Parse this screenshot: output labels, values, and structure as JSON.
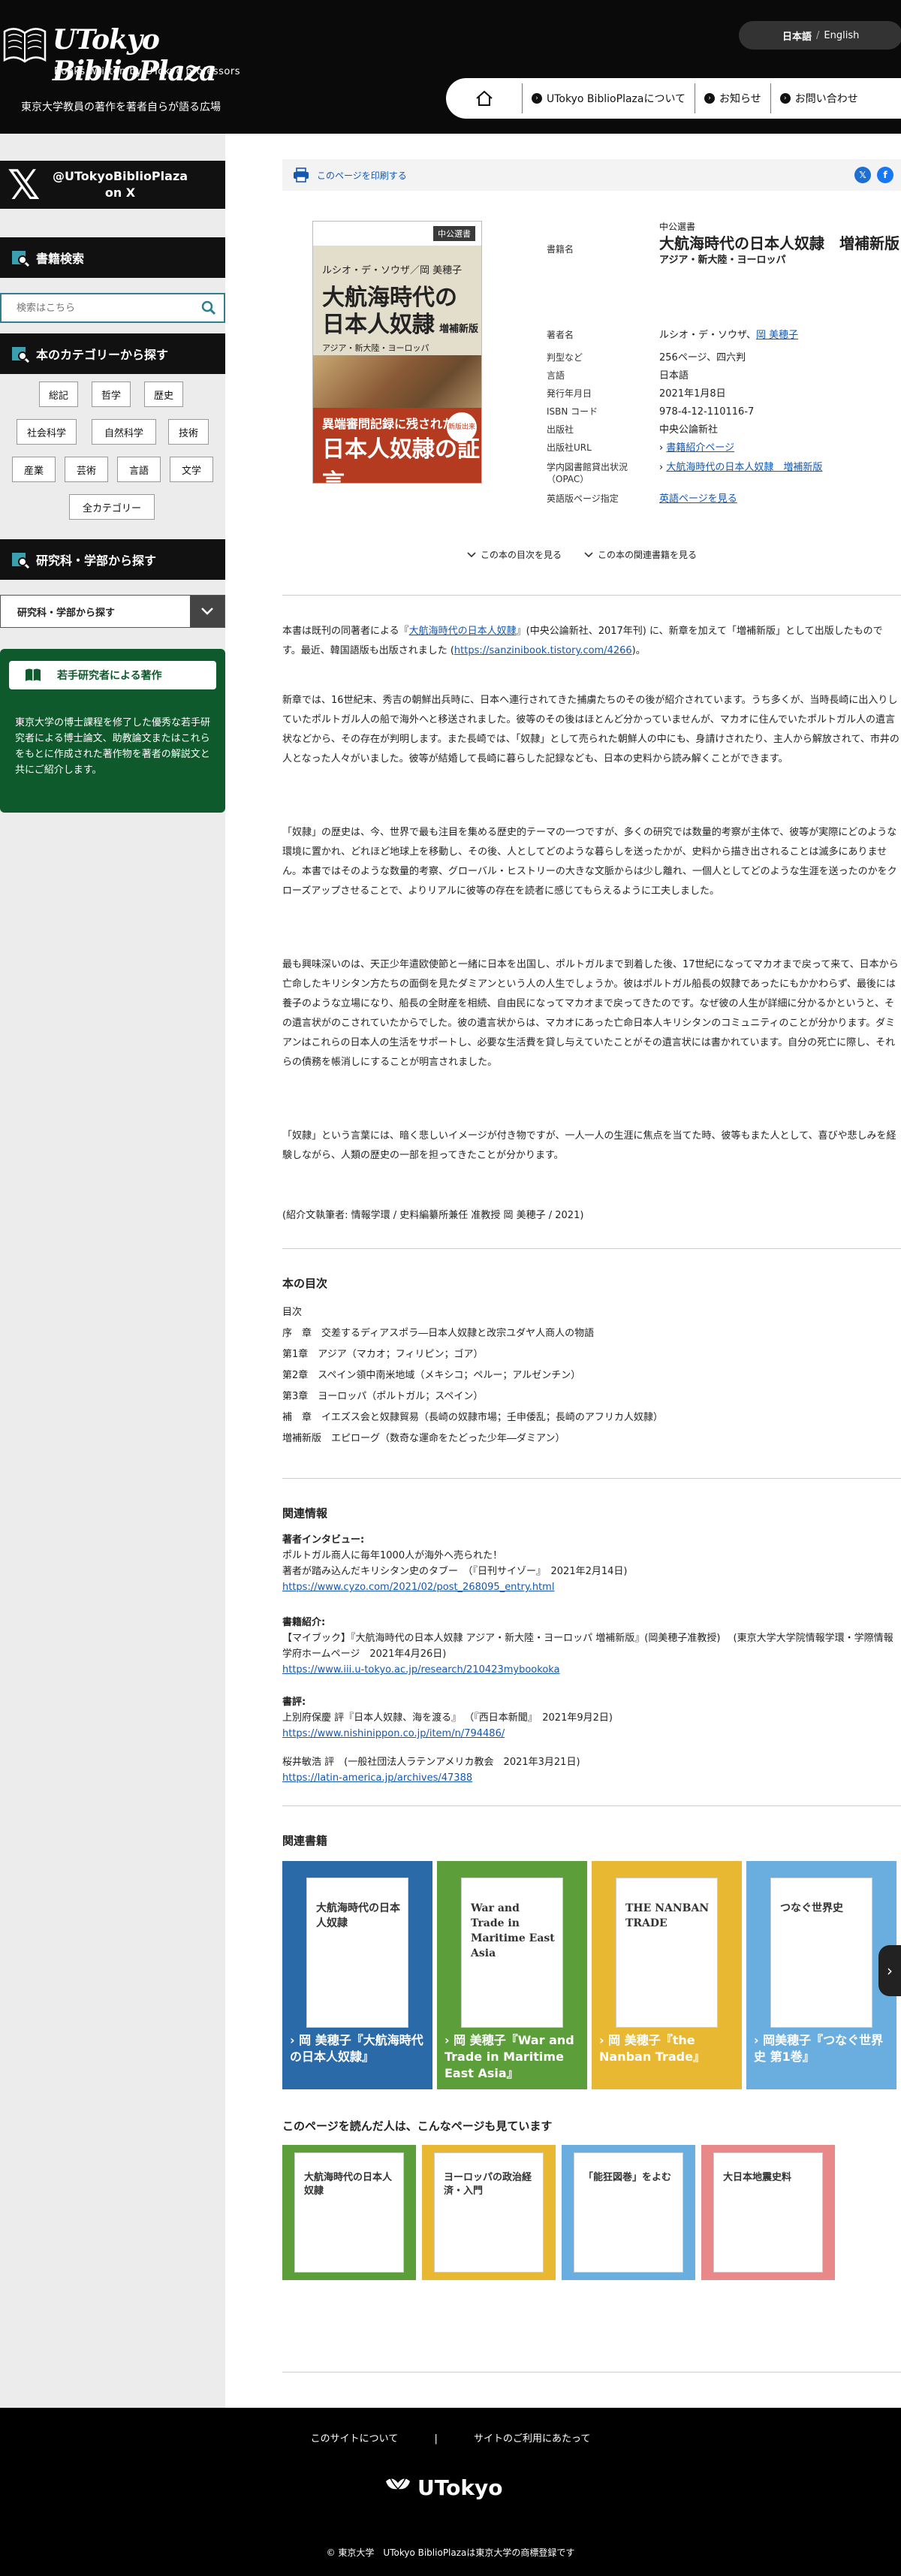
{
  "header": {
    "logo_title": "UTokyo BiblioPlaza",
    "logo_sub": "Books written by UTokyo professors",
    "tagline": "東京大学教員の著作を著者自らが語る広場",
    "lang_current": "日本語",
    "lang_other": "English",
    "nav": [
      "UTokyo BiblioPlazaについて",
      "お知らせ",
      "お問い合わせ"
    ]
  },
  "sidebar": {
    "x_label_1": "@UTokyoBiblioPlaza",
    "x_label_2": "on X",
    "search_title": "書籍検索",
    "search_placeholder": "検索はこちら",
    "category_title": "本のカテゴリーから探す",
    "categories": [
      "総記",
      "哲学",
      "歴史",
      "社会科学",
      "自然科学",
      "技術",
      "産業",
      "芸術",
      "言語",
      "文学",
      "全カテゴリー"
    ],
    "dept_title": "研究科・学部から探す",
    "dept_select": "研究科・学部から探す",
    "young_title": "若手研究者による著作",
    "young_text": "東京大学の博士課程を修了した優秀な若手研究者による博士論文、助教論文またはこれらをもとに作成された著作物を著者の解説文と共にご紹介します。"
  },
  "printbar": {
    "label": "このページを印刷する"
  },
  "cover": {
    "series": "中公選書",
    "author": "ルシオ・デ・ソウザ／岡 美穂子",
    "title_l1": "大航海時代の",
    "title_l2": "日本人奴隷",
    "edition": "増補新版",
    "subtitle": "アジア・新大陸・ヨーロッパ",
    "band1": "異端審問記録に残された",
    "band2": "日本人奴隷の証言",
    "badge": "新版出来"
  },
  "meta": {
    "label_title": "書籍名",
    "publisher_series": "中公選書",
    "title": "大航海時代の日本人奴隷　増補新版",
    "subtitle": "アジア・新大陸・ヨーロッパ",
    "rows": [
      {
        "label": "著者名",
        "value": "ルシオ・デ・ソウザ、"
      },
      {
        "label": "判型など",
        "value": "256ページ、四六判"
      },
      {
        "label": "言語",
        "value": "日本語"
      },
      {
        "label": "発行年月日",
        "value": "2021年1月8日"
      },
      {
        "label": "ISBN コード",
        "value": "978-4-12-110116-7"
      },
      {
        "label": "出版社",
        "value": "中央公論新社"
      },
      {
        "label": "出版社URL",
        "value": "書籍紹介ページ"
      },
      {
        "label": "学内図書館貸出状況（OPAC）",
        "value": "大航海時代の日本人奴隷　増補新版"
      },
      {
        "label": "英語版ページ指定",
        "value": "英語ページを見る"
      }
    ],
    "author_link": "岡 美穂子"
  },
  "toggles": [
    "この本の目次を見る",
    "この本の関連書籍を見る"
  ],
  "article": {
    "p1_a": "本書は既刊の同著者による『",
    "p1_link": "大航海時代の日本人奴隷",
    "p1_b": "』(中央公論新社、2017年刊) に、新章を加えて「増補新版」として出版したものです。最近、韓国語版も出版されました (",
    "p1_url": "https://sanzinibook.tistory.com/4266",
    "p1_c": ")。",
    "p2": "新章では、16世紀末、秀吉の朝鮮出兵時に、日本へ連行されてきた捕虜たちのその後が紹介されています。うち多くが、当時長崎に出入りしていたポルトガル人の船で海外へと移送されました。彼等のその後はほとんど分かっていませんが、マカオに住んでいたポルトガル人の遺言状などから、その存在が判明します。また長崎では、「奴隷」として売られた朝鮮人の中にも、身請けされたり、主人から解放されて、市井の人となった人々がいました。彼等が結婚して長崎に暮らした記録なども、日本の史料から読み解くことができます。",
    "p3": "「奴隷」の歴史は、今、世界で最も注目を集める歴史的テーマの一つですが、多くの研究では数量的考察が主体で、彼等が実際にどのような環境に置かれ、どれほど地球上を移動し、その後、人としてどのような暮らしを送ったかが、史料から描き出されることは滅多にありません。本書ではそのような数量的考察、グローバル・ヒストリーの大きな文脈からは少し離れ、一個人としてどのような生涯を送ったのかをクローズアップさせることで、よりリアルに彼等の存在を読者に感じてもらえるように工夫しました。",
    "p4": "最も興味深いのは、天正少年遣欧使節と一緒に日本を出国し、ポルトガルまで到着した後、17世紀になってマカオまで戻って来て、日本から亡命したキリシタン方たちの面倒を見たダミアンという人の人生でしょうか。彼はポルトガル船長の奴隷であったにもかかわらず、最後には養子のような立場になり、船長の全財産を相続、自由民になってマカオまで戻ってきたのです。なぜ彼の人生が詳細に分かるかというと、その遺言状がのこされていたからでした。彼の遺言状からは、マカオにあった亡命日本人キリシタンのコミュニティのことが分かります。ダミアンはこれらの日本人の生活をサポートし、必要な生活費を貸し与えていたことがその遺言状には書かれています。自分の死亡に際し、それらの債務を帳消しにすることが明言されました。",
    "p5": "「奴隷」という言葉には、暗く悲しいイメージが付き物ですが、一人一人の生涯に焦点を当てた時、彼等もまた人として、喜びや悲しみを経験しながら、人類の歴史の一部を担ってきたことが分かります。",
    "p6": "(紹介文執筆者: 情報学環 / 史料編纂所兼任 准教授 岡 美穂子 / 2021)"
  },
  "toc": {
    "title": "本の目次",
    "items": [
      "目次",
      "序　章　交差するディアスポラ―日本人奴隷と改宗ユダヤ人商人の物語",
      "第1章　アジア（マカオ；フィリピン；ゴア）",
      "第2章　スペイン領中南米地域（メキシコ；ペルー；アルゼンチン）",
      "第3章　ヨーロッパ（ポルトガル；スペイン）",
      "補　章　イエズス会と奴隷貿易（長崎の奴隷市場；壬申倭乱；長崎のアフリカ人奴隷）",
      "増補新版　エピローグ（数奇な運命をたどった少年―ダミアン）"
    ]
  },
  "related": {
    "title": "関連情報",
    "i1_head": "著者インタビュー:",
    "i1_l1": "ポルトガル商人に毎年1000人が海外へ売られた！",
    "i1_l2": "著者が踏み込んだキリシタン史のタブー　（『日刊サイゾー』　2021年2月14日)",
    "i1_url": "https://www.cyzo.com/2021/02/post_268095_entry.html",
    "i2_head": "書籍紹介:",
    "i2_l1": "【マイブック】『大航海時代の日本人奴隷 アジア・新大陸・ヨーロッパ 増補新版』(岡美穂子准教授)　 (東京大学大学院情報学環・学際情報学府ホームページ　2021年4月26日)",
    "i2_url": "https://www.iii.u-tokyo.ac.jp/research/210423mybookoka",
    "i3_head": "書評:",
    "i3_l1": "上別府保慶 評『日本人奴隷、海を渡る』 （『西日本新聞』　2021年9月2日)",
    "i3_url": "https://www.nishinippon.co.jp/item/n/794486/",
    "i4_l1": "桜井敏浩 評　(一般社団法人ラテンアメリカ教会　2021年3月21日)",
    "i4_url": "https://latin-america.jp/archives/47388"
  },
  "related_books": {
    "title": "関連書籍",
    "items": [
      {
        "label": "岡 美穂子『大航海時代の日本人奴隷』",
        "color": "#2a6aa8"
      },
      {
        "label": "岡 美穂子『War and Trade in Maritime East Asia』",
        "color": "#5c9e3a"
      },
      {
        "label": "岡 美穂子『the Nanban Trade』",
        "color": "#e8b832"
      },
      {
        "label": "岡美穂子『つなぐ世界史 第1巻』",
        "color": "#6aaee0"
      }
    ],
    "cover_texts": [
      "大航海時代の日本人奴隷",
      "War and Trade in Maritime East Asia",
      "THE NANBAN TRADE",
      "つなぐ世界史"
    ]
  },
  "also": {
    "title": "このページを読んだ人は、こんなページも見ています",
    "colors": [
      "#5c9e3a",
      "#e8b832",
      "#6aaee0",
      "#e88888"
    ],
    "cover_texts": [
      "大航海時代の日本人奴隷",
      "ヨーロッパの政治経済・入門",
      "「能狂図巻」をよむ",
      "大日本地震史料"
    ]
  },
  "footer": {
    "links": [
      "このサイトについて",
      "|",
      "サイトのご利用にあたって"
    ],
    "brand": "UTokyo",
    "copyright": "© 東京大学　UTokyo BiblioPlazaは東京大学の商標登録です"
  }
}
